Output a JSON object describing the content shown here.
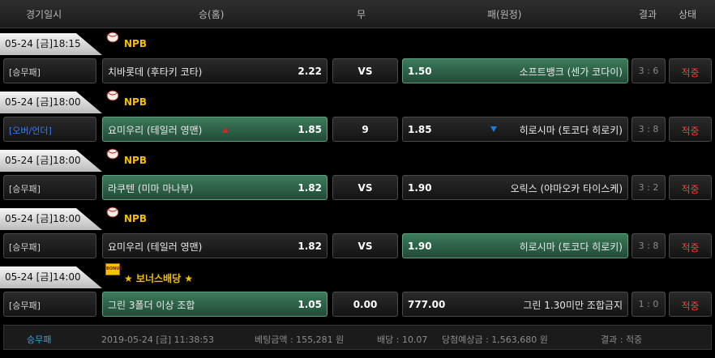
{
  "header": {
    "date": "경기일시",
    "home": "승(홈)",
    "draw": "무",
    "away": "패(원정)",
    "result": "결과",
    "status": "상태"
  },
  "matches": [
    {
      "date": "05-24 [금]18:15",
      "league_icon": "baseball-icon",
      "league": "NPB",
      "bet_type": "[승무패]",
      "home_name": "치바롯데 (후타키 코타)",
      "home_odds": "2.22",
      "draw": "VS",
      "away_odds": "1.50",
      "away_name": "소프트뱅크 (센가 코다이)",
      "result": "3 : 6",
      "status": "적중",
      "selected": "away"
    },
    {
      "date": "05-24 [금]18:00",
      "league_icon": "baseball-icon",
      "league": "NPB",
      "bet_type": "[오버/언더]",
      "home_name": "요미우리 (테일러 영맨)",
      "home_odds": "1.85",
      "draw": "9",
      "away_odds": "1.85",
      "away_name": "히로시마 (토코다 히로키)",
      "result": "3 : 8",
      "status": "적중",
      "selected": "home"
    },
    {
      "date": "05-24 [금]18:00",
      "league_icon": "baseball-icon",
      "league": "NPB",
      "bet_type": "[승무패]",
      "home_name": "라쿠텐 (미마 마나부)",
      "home_odds": "1.82",
      "draw": "VS",
      "away_odds": "1.90",
      "away_name": "오릭스 (야마오카 타이스케)",
      "result": "3 : 2",
      "status": "적중",
      "selected": "home"
    },
    {
      "date": "05-24 [금]18:00",
      "league_icon": "baseball-icon",
      "league": "NPB",
      "bet_type": "[승무패]",
      "home_name": "요미우리 (테일러 영맨)",
      "home_odds": "1.82",
      "draw": "VS",
      "away_odds": "1.90",
      "away_name": "히로시마 (토코다 히로키)",
      "result": "3 : 8",
      "status": "적중",
      "selected": "away"
    },
    {
      "date": "05-24 [금]14:00",
      "league_icon": "bonus-icon",
      "league_badge": "BONUS",
      "league": "★ 보너스배당 ★",
      "bet_type": "[승무패]",
      "home_name": "그린 3폴더 이상 조합",
      "home_odds": "1.05",
      "draw": "0.00",
      "away_odds": "777.00",
      "away_name": "그린 1.30미만 조합금지",
      "result": "1 : 0",
      "status": "적중",
      "selected": "home"
    }
  ],
  "footer": {
    "type": "승무패",
    "datetime": "2019-05-24 [금] 11:38:53",
    "bet_amount": "베팅금액 : 155,281 원",
    "odds": "배당 : 10.07",
    "expected_win": "당첨예상금 : 1,563,680 원",
    "result": "결과 : 적중"
  },
  "colors": {
    "selected_green": "#3b7b5a",
    "league_gold": "#f0c000",
    "status_red": "#ff3b3b",
    "overunder_blue": "#3a7cff"
  }
}
